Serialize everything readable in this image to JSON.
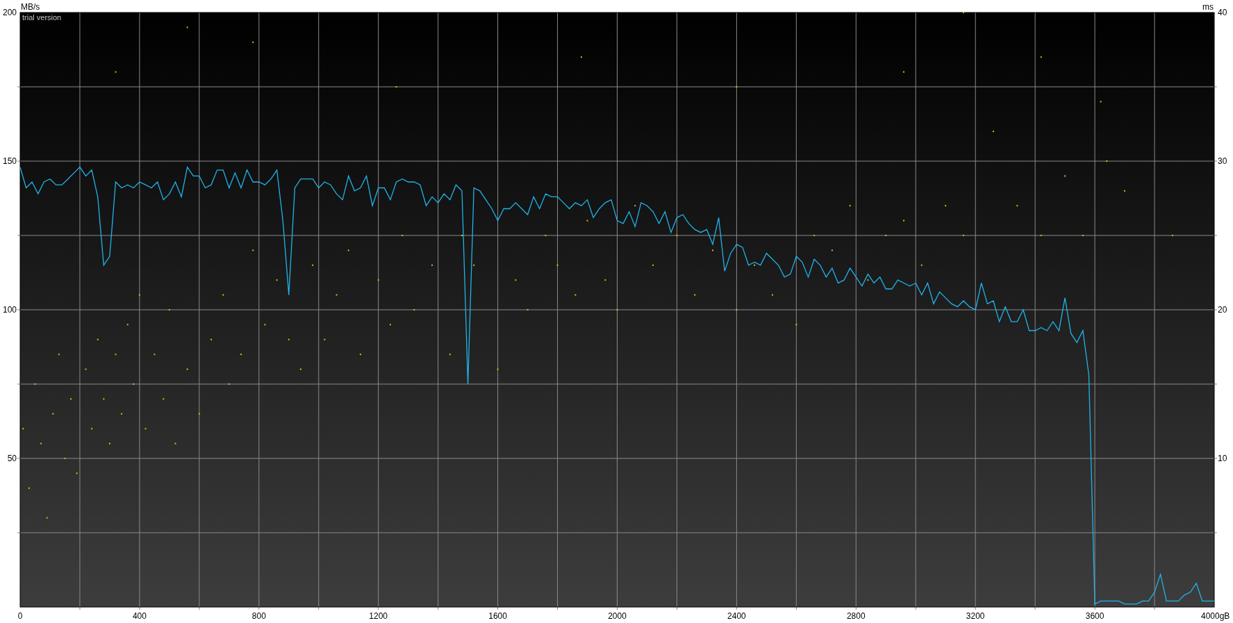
{
  "chart": {
    "notice": "trial version",
    "chart_data": {
      "type": "line",
      "grid": true,
      "ylabel": "MB/s",
      "y2label": "ms",
      "xlim": [
        0,
        4000
      ],
      "ylim": [
        0,
        200
      ],
      "y2lim": [
        0,
        40
      ],
      "xticks": [
        0,
        400,
        800,
        1200,
        1600,
        2000,
        2400,
        2800,
        3200,
        3600,
        {
          "value": 4000,
          "label": "4000gB"
        }
      ],
      "yticks": [
        50,
        100,
        150,
        200
      ],
      "y2ticks": [
        10,
        20,
        30,
        40
      ],
      "series": [
        {
          "color": "#1fb4ea",
          "x": [
            0,
            20,
            40,
            60,
            80,
            100,
            120,
            140,
            160,
            180,
            200,
            220,
            240,
            260,
            280,
            300,
            320,
            340,
            360,
            380,
            400,
            420,
            440,
            460,
            480,
            500,
            520,
            540,
            560,
            580,
            600,
            620,
            640,
            660,
            680,
            700,
            720,
            740,
            760,
            780,
            800,
            820,
            840,
            860,
            880,
            900,
            920,
            940,
            960,
            980,
            1000,
            1020,
            1040,
            1060,
            1080,
            1100,
            1120,
            1140,
            1160,
            1180,
            1200,
            1220,
            1240,
            1260,
            1280,
            1300,
            1320,
            1340,
            1360,
            1380,
            1400,
            1420,
            1440,
            1460,
            1480,
            1500,
            1520,
            1540,
            1560,
            1580,
            1600,
            1620,
            1640,
            1660,
            1680,
            1700,
            1720,
            1740,
            1760,
            1780,
            1800,
            1820,
            1840,
            1860,
            1880,
            1900,
            1920,
            1940,
            1960,
            1980,
            2000,
            2020,
            2040,
            2060,
            2080,
            2100,
            2120,
            2140,
            2160,
            2180,
            2200,
            2220,
            2240,
            2260,
            2280,
            2300,
            2320,
            2340,
            2360,
            2380,
            2400,
            2420,
            2440,
            2460,
            2480,
            2500,
            2520,
            2540,
            2560,
            2580,
            2600,
            2620,
            2640,
            2660,
            2680,
            2700,
            2720,
            2740,
            2760,
            2780,
            2800,
            2820,
            2840,
            2860,
            2880,
            2900,
            2920,
            2940,
            2960,
            2980,
            3000,
            3020,
            3040,
            3060,
            3080,
            3100,
            3120,
            3140,
            3160,
            3180,
            3200,
            3220,
            3240,
            3260,
            3280,
            3300,
            3320,
            3340,
            3360,
            3380,
            3400,
            3420,
            3440,
            3460,
            3480,
            3500,
            3520,
            3540,
            3560,
            3580,
            3600,
            3620,
            3640,
            3660,
            3680,
            3700,
            3720,
            3740,
            3760,
            3780,
            3800,
            3820,
            3840,
            3860,
            3880,
            3900,
            3920,
            3940,
            3960,
            3980,
            4000
          ],
          "values": [
            148,
            141,
            143,
            139,
            143,
            144,
            142,
            142,
            144,
            146,
            148,
            145,
            147,
            138,
            115,
            118,
            143,
            141,
            142,
            141,
            143,
            142,
            141,
            143,
            137,
            139,
            143,
            138,
            148,
            145,
            145,
            141,
            142,
            147,
            147,
            141,
            146,
            141,
            147,
            143,
            143,
            142,
            144,
            147,
            130,
            105,
            141,
            144,
            144,
            144,
            141,
            143,
            142,
            139,
            137,
            145,
            140,
            141,
            145,
            135,
            141,
            141,
            137,
            143,
            144,
            143,
            143,
            142,
            135,
            138,
            136,
            139,
            137,
            142,
            140,
            75,
            141,
            140,
            137,
            134,
            130,
            134,
            134,
            136,
            134,
            132,
            138,
            134,
            139,
            138,
            138,
            136,
            134,
            136,
            135,
            137,
            131,
            134,
            136,
            137,
            130,
            129,
            133,
            128,
            136,
            135,
            133,
            129,
            133,
            126,
            131,
            132,
            129,
            127,
            126,
            127,
            122,
            131,
            113,
            119,
            122,
            121,
            115,
            116,
            115,
            119,
            117,
            115,
            111,
            112,
            118,
            116,
            111,
            117,
            115,
            111,
            114,
            109,
            110,
            114,
            111,
            108,
            112,
            109,
            111,
            107,
            107,
            110,
            109,
            108,
            109,
            105,
            109,
            102,
            106,
            104,
            102,
            101,
            103,
            101,
            100,
            109,
            102,
            103,
            96,
            101,
            96,
            96,
            100,
            93,
            93,
            94,
            93,
            96,
            93,
            104,
            92,
            89,
            93,
            78,
            1,
            2,
            2,
            2,
            2,
            1,
            1,
            1,
            2,
            2,
            5,
            11,
            2,
            2,
            2,
            4,
            5,
            8,
            2,
            2,
            2
          ]
        },
        {
          "type": "scatter",
          "axis": "y2",
          "color": "#c8c31e",
          "x": [
            10,
            30,
            50,
            70,
            90,
            110,
            130,
            150,
            170,
            190,
            220,
            240,
            260,
            280,
            300,
            320,
            320,
            340,
            360,
            380,
            400,
            420,
            450,
            480,
            500,
            520,
            560,
            560,
            600,
            640,
            680,
            700,
            740,
            780,
            780,
            820,
            860,
            900,
            940,
            980,
            1020,
            1060,
            1100,
            1140,
            1200,
            1240,
            1260,
            1280,
            1320,
            1380,
            1440,
            1480,
            1520,
            1600,
            1660,
            1700,
            1760,
            1800,
            1860,
            1880,
            1900,
            1960,
            2000,
            2060,
            2120,
            2200,
            2260,
            2320,
            2400,
            2400,
            2460,
            2520,
            2600,
            2660,
            2720,
            2780,
            2840,
            2900,
            2960,
            2960,
            3020,
            3100,
            3160,
            3160,
            3260,
            3340,
            3420,
            3420,
            3500,
            3560,
            3620,
            3640,
            3700,
            3860
          ],
          "values": [
            12,
            8,
            15,
            11,
            6,
            13,
            17,
            10,
            14,
            9,
            16,
            12,
            18,
            14,
            11,
            17,
            36,
            13,
            19,
            15,
            21,
            12,
            17,
            14,
            20,
            11,
            16,
            39,
            13,
            18,
            21,
            15,
            17,
            24,
            38,
            19,
            22,
            18,
            16,
            23,
            18,
            21,
            24,
            17,
            22,
            19,
            35,
            25,
            20,
            23,
            17,
            25,
            23,
            16,
            22,
            20,
            25,
            23,
            21,
            37,
            26,
            22,
            20,
            27,
            23,
            25,
            21,
            24,
            20,
            35,
            23,
            21,
            19,
            25,
            24,
            27,
            22,
            25,
            26,
            36,
            23,
            27,
            25,
            40,
            32,
            27,
            25,
            37,
            29,
            25,
            34,
            30,
            28,
            25
          ]
        }
      ]
    }
  }
}
